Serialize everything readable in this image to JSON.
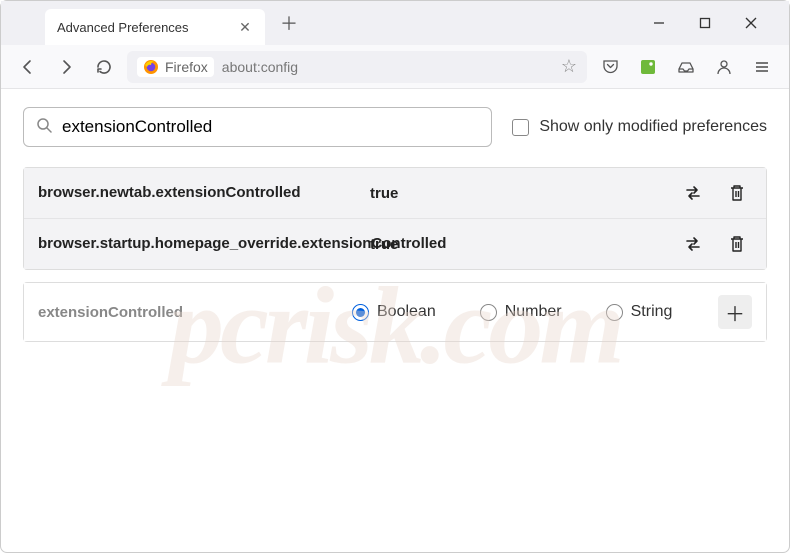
{
  "window": {
    "tab_title": "Advanced Preferences"
  },
  "toolbar": {
    "identity_label": "Firefox",
    "url": "about:config"
  },
  "search": {
    "value": "extensionControlled",
    "show_modified_label": "Show only modified preferences"
  },
  "prefs": [
    {
      "name": "browser.newtab.extensionControlled",
      "value": "true"
    },
    {
      "name": "browser.startup.homepage_override.extensionControlled",
      "value": "true"
    }
  ],
  "new_pref": {
    "name": "extensionControlled",
    "types": [
      "Boolean",
      "Number",
      "String"
    ],
    "selected": "Boolean"
  },
  "watermark": "pcrisk.com"
}
